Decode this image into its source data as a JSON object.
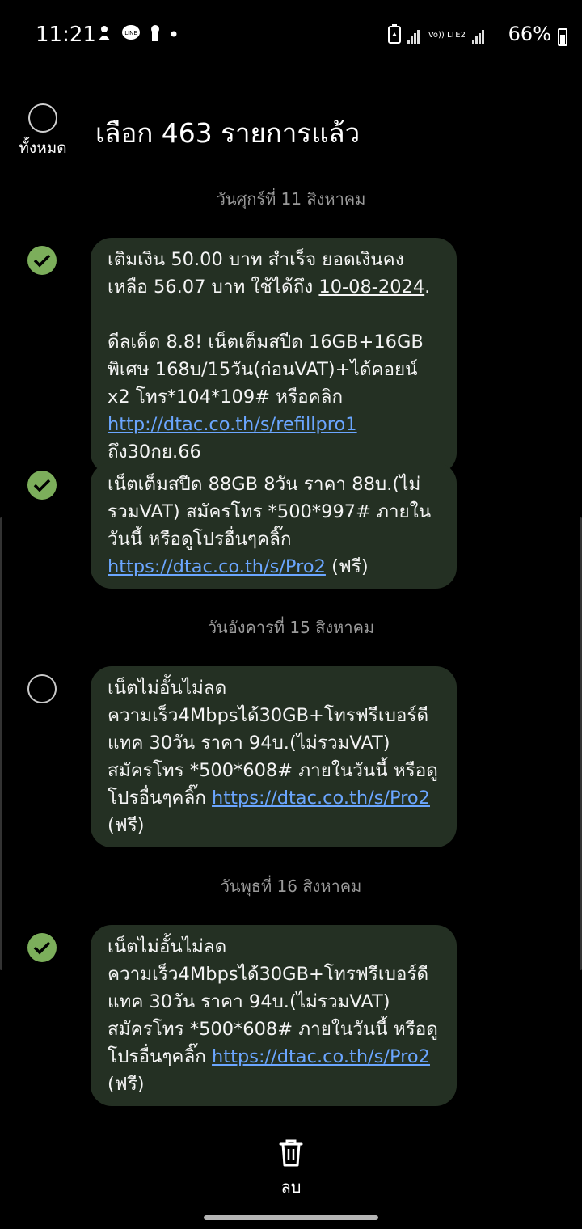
{
  "status": {
    "time": "11:21",
    "battery": "66%",
    "network": "Vo)) LTE2",
    "icons": [
      "notification-icon",
      "line-app-icon",
      "keyhole-icon",
      "dot-icon",
      "battery-saver-icon",
      "signal-icon",
      "signal-icon",
      "battery-icon"
    ]
  },
  "header": {
    "select_all_label": "ทั้งหมด",
    "title": "เลือก 463 รายการแล้ว"
  },
  "dates": {
    "d1": "วันศุกร์ที่ 11 สิงหาคม",
    "d2": "วันอังคารที่ 15 สิงหาคม",
    "d3": "วันพุธที่ 16 สิงหาคม"
  },
  "messages": [
    {
      "selected": true,
      "part1": "เติมเงิน 50.00 บาท สำเร็จ ยอดเงินคงเหลือ 56.07 บาท ใช้ได้ถึง ",
      "date": "10-08-2024",
      "part2": ".\n\nดีลเด็ด 8.8! เน็ตเต็มสปีด 16GB+16GB พิเศษ 168บ/15วัน(ก่อนVAT)+ได้คอยน์ x2 โทร*104*109# หรือคลิก ",
      "link": "http://dtac.co.th/s/refillpro1",
      "part3": " ถึง30กย.66"
    },
    {
      "selected": true,
      "part1": "เน็ตเต็มสปีด 88GB 8วัน ราคา 88บ.(ไม่รวมVAT) สมัครโทร *500*997# ภายในวันนี้ หรือดูโปรอื่นๆคลิ๊ก ",
      "link": "https://dtac.co.th/s/Pro2",
      "part2": " (ฟรี)"
    },
    {
      "selected": false,
      "part1": "เน็ตไม่อั้นไม่ลด\nความเร็ว4Mbpsได้30GB+โทรฟรีเบอร์ดีแทค 30วัน ราคา 94บ.(ไม่รวมVAT) สมัครโทร *500*608# ภายในวันนี้ หรือดูโปรอื่นๆคลิ๊ก ",
      "link": "https://dtac.co.th/s/Pro2",
      "part2": " (ฟรี)"
    },
    {
      "selected": true,
      "part1": "เน็ตไม่อั้นไม่ลด\nความเร็ว4Mbpsได้30GB+โทรฟรีเบอร์ดีแทค 30วัน ราคา 94บ.(ไม่รวมVAT) สมัครโทร *500*608# ภายในวันนี้ หรือดูโปรอื่นๆคลิ๊ก ",
      "link": "https://dtac.co.th/s/Pro2",
      "part2": " (ฟรี)"
    }
  ],
  "bottom": {
    "delete_label": "ลบ"
  },
  "colors": {
    "bubble": "#243023",
    "check": "#7cae5b",
    "link": "#6ba6ff",
    "background": "#000000"
  }
}
